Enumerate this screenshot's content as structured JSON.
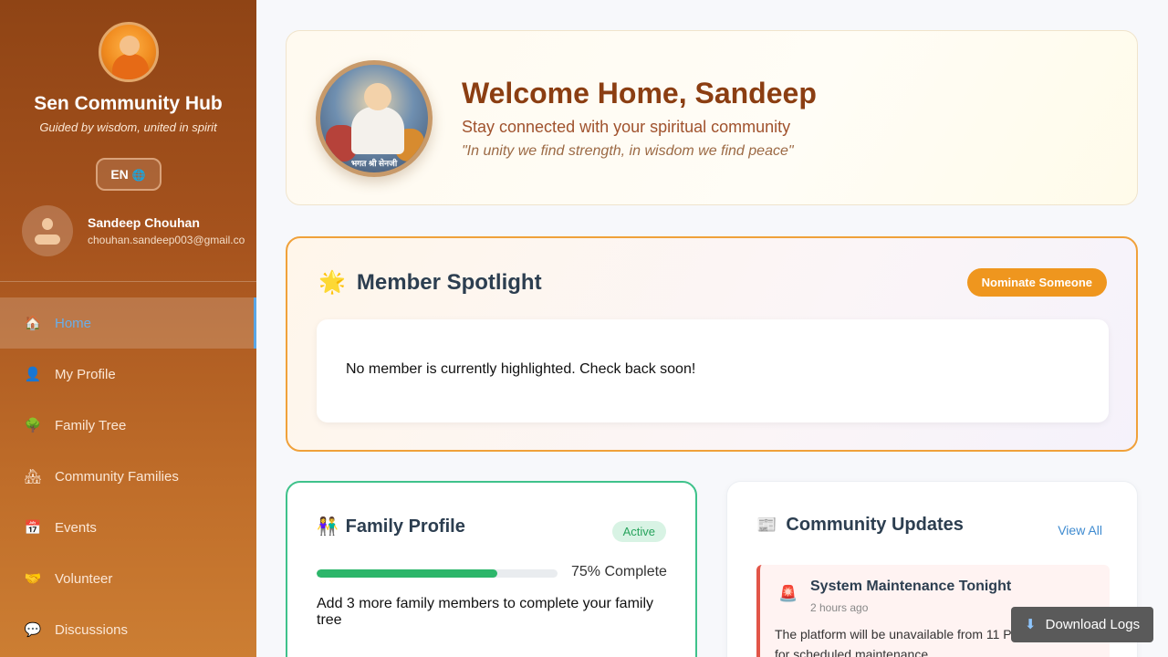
{
  "sidebar": {
    "app_title": "Sen Community Hub",
    "tagline": "Guided by wisdom, united in spirit",
    "language": "EN",
    "language_icon": "globe-icon",
    "user": {
      "name": "Sandeep Chouhan",
      "email": "chouhan.sandeep003@gmail.co"
    },
    "nav": [
      {
        "label": "Home",
        "icon": "🏠",
        "icon_name": "home-icon",
        "active": true
      },
      {
        "label": "My Profile",
        "icon": "👤",
        "icon_name": "user-icon"
      },
      {
        "label": "Family Tree",
        "icon": "🌳",
        "icon_name": "tree-icon"
      },
      {
        "label": "Community Families",
        "icon": "🏘",
        "icon_name": "houses-icon"
      },
      {
        "label": "Events",
        "icon": "📅",
        "icon_name": "calendar-icon"
      },
      {
        "label": "Volunteer",
        "icon": "🤝",
        "icon_name": "handshake-icon"
      },
      {
        "label": "Discussions",
        "icon": "💬",
        "icon_name": "chat-icon"
      }
    ]
  },
  "welcome": {
    "title": "Welcome Home, Sandeep",
    "subtitle": "Stay connected with your spiritual community",
    "quote": "\"In unity we find strength, in wisdom we find peace\"",
    "image_caption": "भगत श्री सेनजी"
  },
  "spotlight": {
    "icon": "🌟",
    "title": "Member Spotlight",
    "nominate_label": "Nominate Someone",
    "empty_message": "No member is currently highlighted. Check back soon!"
  },
  "family_profile": {
    "icon": "👫",
    "title": "Family Profile",
    "status": "Active",
    "progress_percent": 75,
    "progress_label": "75% Complete",
    "note": "Add 3 more family members to complete your family tree"
  },
  "community_updates": {
    "icon": "📰",
    "title": "Community Updates",
    "view_all": "View All",
    "items": [
      {
        "icon": "🚨",
        "title": "System Maintenance Tonight",
        "time": "2 hours ago",
        "text": "The platform will be unavailable from 11 PM to 1 AM for scheduled maintenance."
      }
    ]
  },
  "download_logs": {
    "icon": "⬇",
    "label": "Download Logs"
  },
  "colors": {
    "brand_brown": "#8b3e12",
    "accent_orange": "#ef961e",
    "success_green": "#2cb66a",
    "alert_red": "#e25548",
    "link_blue": "#3f8bd0"
  }
}
